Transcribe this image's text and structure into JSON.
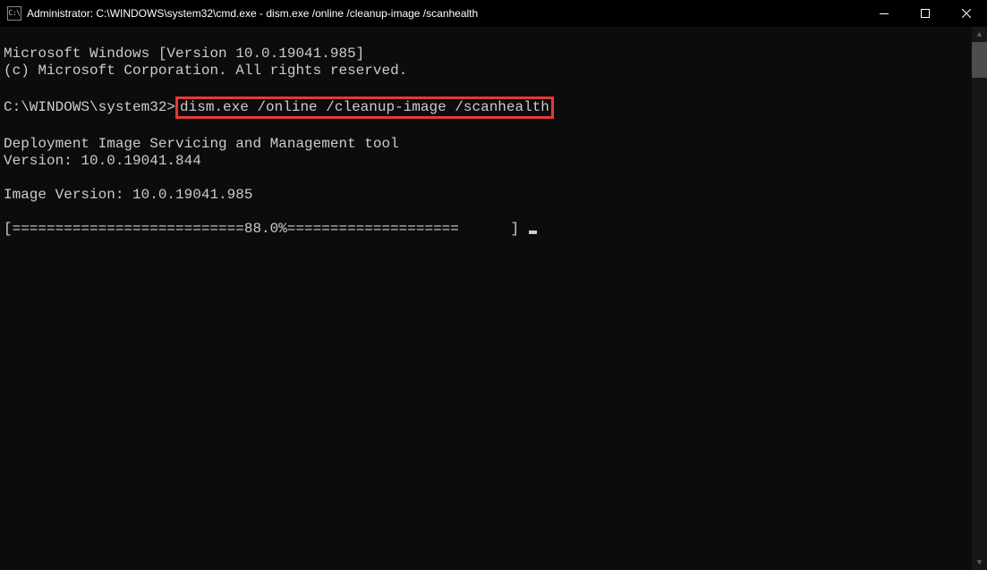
{
  "titlebar": {
    "icon_text": "C:\\",
    "title": "Administrator: C:\\WINDOWS\\system32\\cmd.exe - dism.exe  /online /cleanup-image /scanhealth"
  },
  "terminal": {
    "line1": "Microsoft Windows [Version 10.0.19041.985]",
    "line2": "(c) Microsoft Corporation. All rights reserved.",
    "blank1": "",
    "prompt_prefix": "C:\\WINDOWS\\system32>",
    "command": "dism.exe /online /cleanup-image /scanhealth",
    "blank2": "",
    "tool_line1": "Deployment Image Servicing and Management tool",
    "tool_line2": "Version: 10.0.19041.844",
    "blank3": "",
    "image_version": "Image Version: 10.0.19041.985",
    "blank4": "",
    "progress": "[===========================88.0%====================      ] "
  }
}
